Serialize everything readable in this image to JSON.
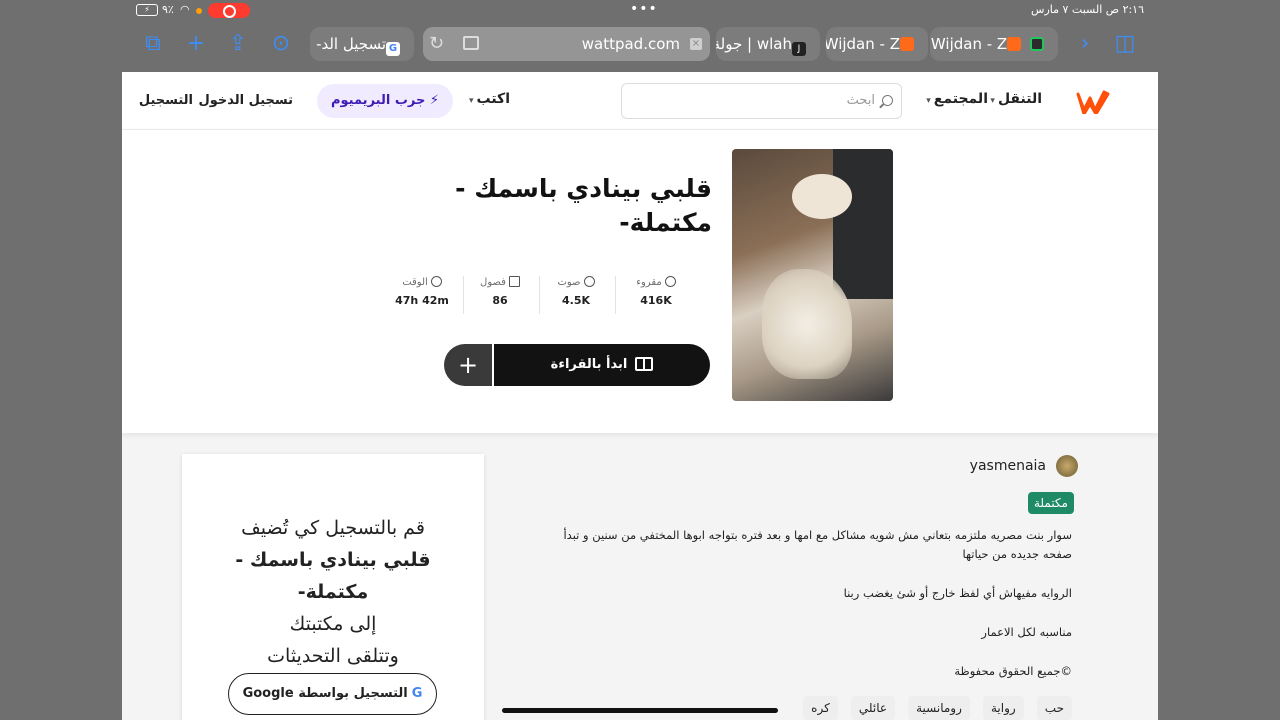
{
  "status": {
    "clock": "٢:١٦ ص   السبت ٧ مارس",
    "battery": "⚡",
    "battery_pct": "٩٪"
  },
  "browser": {
    "tabs": [
      {
        "label": "تسجيل الد-",
        "icon": "google-favicon"
      },
      {
        "label": "wlah | جولة",
        "icon": "j-favicon"
      },
      {
        "label": "Wijdan - Z",
        "icon": "wattpad-favicon"
      },
      {
        "label": "Wijdan - Z",
        "icon": "wattpad-favicon"
      }
    ],
    "address": "wattpad.com",
    "accent": "#3e8df5"
  },
  "header": {
    "nav": [
      {
        "label": "التنقل"
      },
      {
        "label": "المجتمع"
      }
    ],
    "search_placeholder": "ابحث",
    "write": "اكتب",
    "premium": "جرب البريميوم",
    "login": "تسجيل الدخول",
    "signup": "التسجيل",
    "brand_color": "#ff500a"
  },
  "story": {
    "title": "قلبي بينادي باسمك - مكتملة-",
    "stats": [
      {
        "label": "مقروء",
        "value": "416K",
        "icon": "eye-icon"
      },
      {
        "label": "صوت",
        "value": "4.5K",
        "icon": "star-icon"
      },
      {
        "label": "فصول",
        "value": "86",
        "icon": "list-icon"
      },
      {
        "label": "الوقت",
        "value": "47h 42m",
        "icon": "clock-icon"
      }
    ],
    "read_button": "ابدأ بالقراءة",
    "add_button": "+"
  },
  "about": {
    "author": "yasmenaia",
    "status_badge": "مكتملة",
    "badge_color": "#1f8b66",
    "description": [
      "سوار بنت مصريه ملتزمه بتعاني مش شويه مشاكل مع امها و بعد فتره بتواجه ابوها المختفي من سنين و تبدأ صفحه جديده من حياتها",
      "الروايه مفيهاش أي لفظ خارج أو شئ يغضب ربنا",
      "مناسبه لكل الاعمار",
      "©جميع الحقوق محفوظة"
    ],
    "tags": [
      "حب",
      "رواية",
      "رومانسية",
      "عائلي",
      "كره"
    ]
  },
  "signup_card": {
    "line1": "قم بالتسجيل كي تُضيف",
    "story_name": "قلبي بينادي باسمك - مكتملة-",
    "line2": "إلى مكتبتك",
    "line3": "وتتلقى التحديثات",
    "google_button": "التسجيل بواسطة Google"
  }
}
